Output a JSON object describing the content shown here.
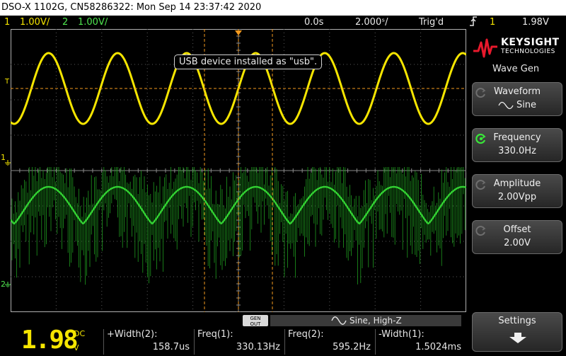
{
  "title_bar": {
    "text": "DSO-X 1102G, CN58286322: Mon Sep 14 23:37:42 2020"
  },
  "status_bar": {
    "ch1_num": "1",
    "ch1_scale": "1.00V/",
    "ch2_num": "2",
    "ch2_scale": "1.00V/",
    "time_delay": "0.0s",
    "time_scale": "2.000ˢ/",
    "trigger_state": "Trig'd",
    "trigger_channel": "1",
    "trigger_level": "1.98V"
  },
  "tooltip": {
    "text": "USB device installed as \"usb\"."
  },
  "waveforms": {
    "ch1": {
      "color": "#f5e500",
      "cycles_on_screen": 6.6,
      "amplitude_div": 1.0
    },
    "ch2": {
      "color": "#32d132",
      "cycles_on_screen": 6.6
    }
  },
  "markers": {
    "ch1": "1",
    "ch2": "2",
    "trigger": "T"
  },
  "gen_out": {
    "line1": "GEN",
    "line2": "OUT",
    "readout": "Sine, High-Z",
    "wave_icon": "sine-icon"
  },
  "big_readout": {
    "value": "1.98",
    "mode": "DC",
    "unit": "V"
  },
  "measurements": [
    {
      "label": "+Width(2):",
      "value": "158.7us"
    },
    {
      "label": "Freq(1):",
      "value": "330.13Hz"
    },
    {
      "label": "Freq(2):",
      "value": "595.2Hz"
    },
    {
      "label": "-Width(1):",
      "value": "1.5024ms"
    }
  ],
  "brand": {
    "name": "KEYSIGHT",
    "sub": "TECHNOLOGIES",
    "color": "#e8192c"
  },
  "menu": {
    "title": "Wave Gen",
    "softkeys": [
      {
        "label": "Waveform",
        "value": "Sine",
        "value_icon": "sine-icon",
        "active": false
      },
      {
        "label": "Frequency",
        "value": "330.0Hz",
        "active": true
      },
      {
        "label": "Amplitude",
        "value": "2.00Vpp",
        "active": false
      },
      {
        "label": "Offset",
        "value": "2.00V",
        "active": false
      }
    ],
    "settings_label": "Settings"
  }
}
